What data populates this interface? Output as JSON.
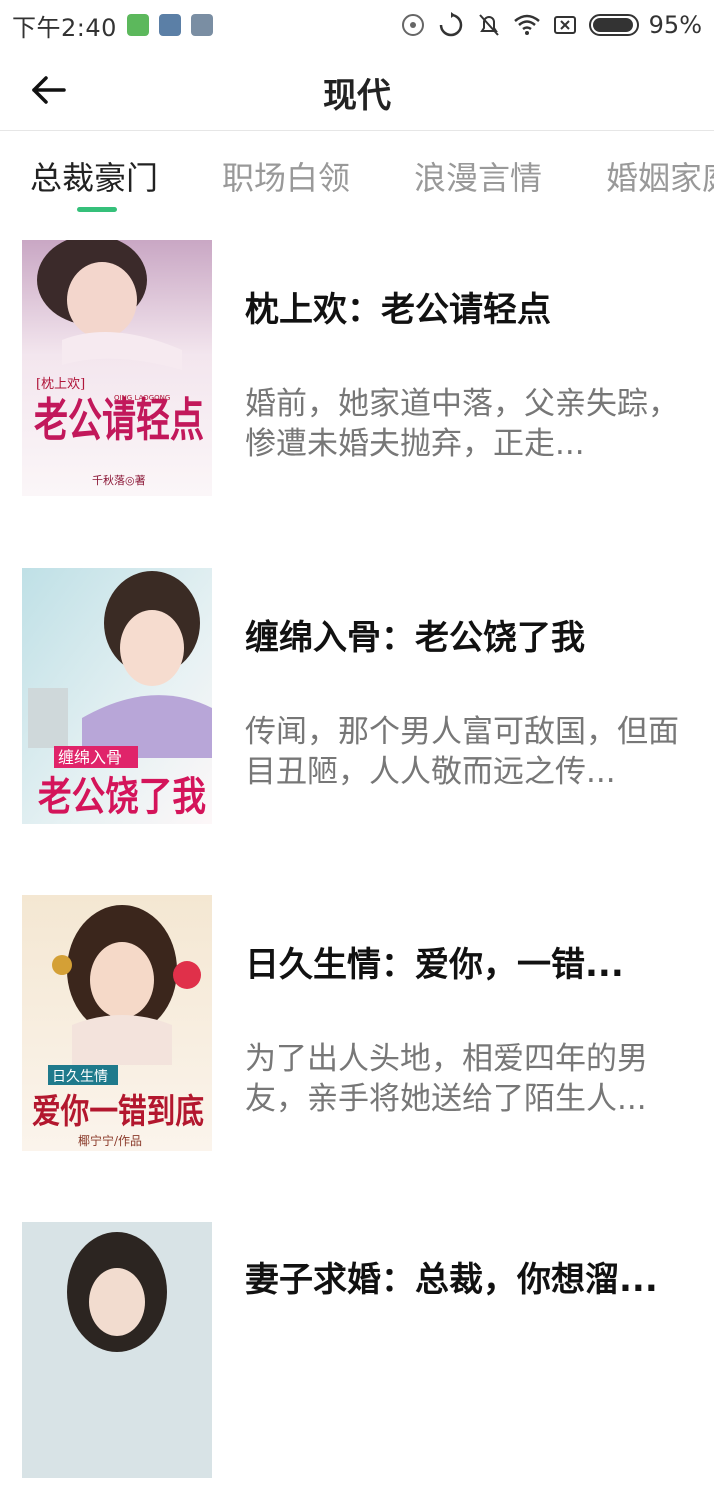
{
  "status_bar": {
    "time": "下午2:40",
    "battery": "95%",
    "battery_level": 0.95
  },
  "header": {
    "title": "现代"
  },
  "tabs": [
    {
      "label": "总裁豪门",
      "active": true
    },
    {
      "label": "职场白领",
      "active": false
    },
    {
      "label": "浪漫言情",
      "active": false
    },
    {
      "label": "婚姻家庭",
      "active": false
    }
  ],
  "books": [
    {
      "title": "枕上欢：老公请轻点",
      "description": "婚前，她家道中落，父亲失踪，惨遭未婚夫抛弃，正走...",
      "cover": {
        "tag": "[枕上欢]",
        "main": "老公请轻点",
        "sub": "QING LAOGONG",
        "author": "千秋落◎著"
      }
    },
    {
      "title": "缠绵入骨：老公饶了我",
      "description": "传闻，那个男人富可敌国，但面目丑陋，人人敬而远之传...",
      "cover": {
        "tag": "缠绵入骨",
        "main": "老公饶了我"
      }
    },
    {
      "title": "日久生情：爱你，一错...",
      "description": "为了出人头地，相爱四年的男友，亲手将她送给了陌生人...",
      "cover": {
        "tag": "日久生情",
        "main": "爱你一错到底",
        "author": "椰宁宁/作品"
      }
    },
    {
      "title": "妻子求婚：总裁，你想溜...",
      "description": ""
    }
  ],
  "colors": {
    "accent": "#35c07a",
    "title_text": "#111111",
    "desc_text": "#777777",
    "tab_inactive": "#999999"
  }
}
